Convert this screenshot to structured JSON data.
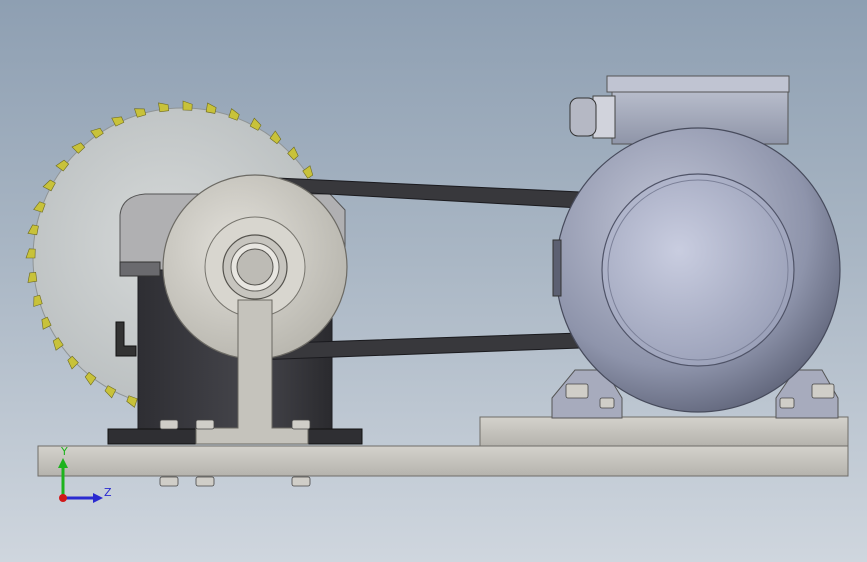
{
  "triad": {
    "y_label": "Y",
    "z_label": "Z",
    "y_color": "#1db31d",
    "z_color": "#2a2ad0",
    "origin_color": "#d01818"
  },
  "colors": {
    "background_top": "#8e9fb2",
    "background_bottom": "#cfd6de",
    "blade": "#c9cdcd",
    "blade_teeth": "#c8c23a",
    "pulley": "#cfcdc6",
    "bearing_housing": "#3c3c40",
    "base_plate": "#c4c2bc",
    "belt": "#3a3a3e",
    "motor": "#9ea3b8",
    "motor_face": "#b4b8cc"
  }
}
